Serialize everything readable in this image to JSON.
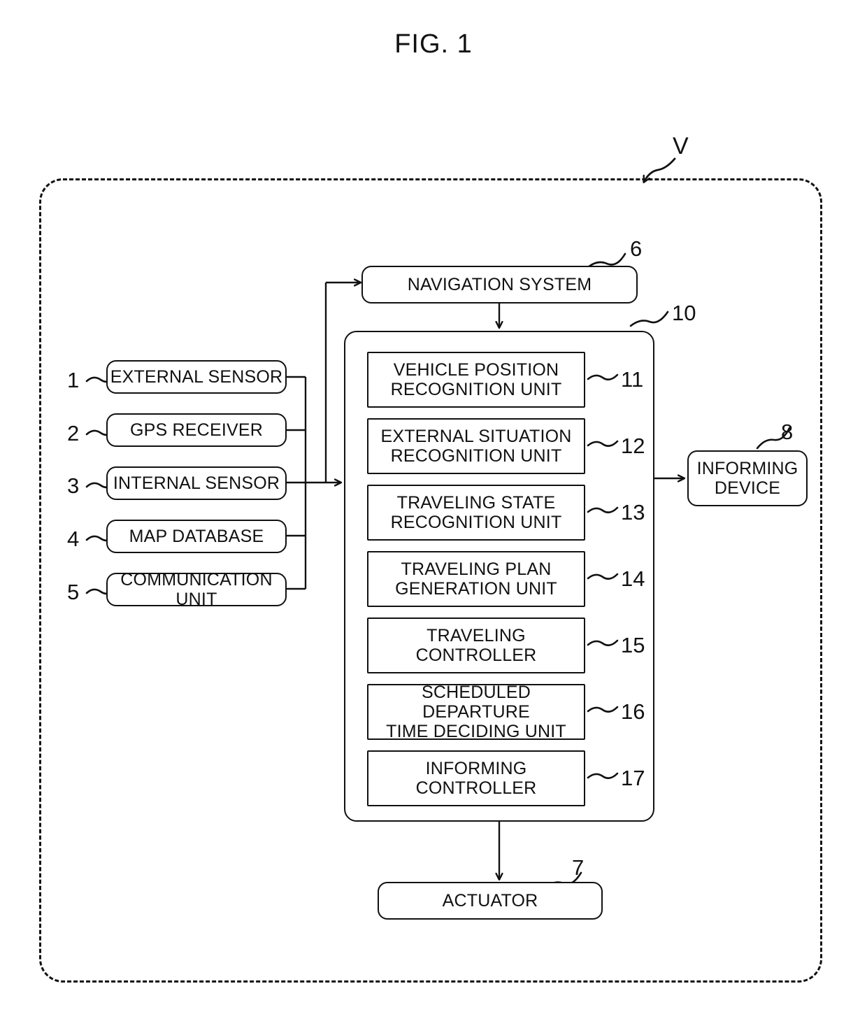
{
  "figure": {
    "title": "FIG. 1",
    "vehicle_ref": "V"
  },
  "inputs": {
    "items": [
      {
        "ref": "1",
        "label": "EXTERNAL SENSOR"
      },
      {
        "ref": "2",
        "label": "GPS RECEIVER"
      },
      {
        "ref": "3",
        "label": "INTERNAL SENSOR"
      },
      {
        "ref": "4",
        "label": "MAP DATABASE"
      },
      {
        "ref": "5",
        "label": "COMMUNICATION UNIT"
      }
    ]
  },
  "navigation": {
    "ref": "6",
    "label": "NAVIGATION SYSTEM"
  },
  "ecu": {
    "ref": "10",
    "units": [
      {
        "ref": "11",
        "label": "VEHICLE POSITION\nRECOGNITION UNIT"
      },
      {
        "ref": "12",
        "label": "EXTERNAL SITUATION\nRECOGNITION UNIT"
      },
      {
        "ref": "13",
        "label": "TRAVELING STATE\nRECOGNITION UNIT"
      },
      {
        "ref": "14",
        "label": "TRAVELING PLAN\nGENERATION UNIT"
      },
      {
        "ref": "15",
        "label": "TRAVELING CONTROLLER"
      },
      {
        "ref": "16",
        "label": "SCHEDULED DEPARTURE\nTIME DECIDING UNIT"
      },
      {
        "ref": "17",
        "label": "INFORMING CONTROLLER"
      }
    ]
  },
  "informing_device": {
    "ref": "8",
    "label": "INFORMING\nDEVICE"
  },
  "actuator": {
    "ref": "7",
    "label": "ACTUATOR"
  },
  "style": {
    "ink": "#111111",
    "paper": "#ffffff"
  }
}
